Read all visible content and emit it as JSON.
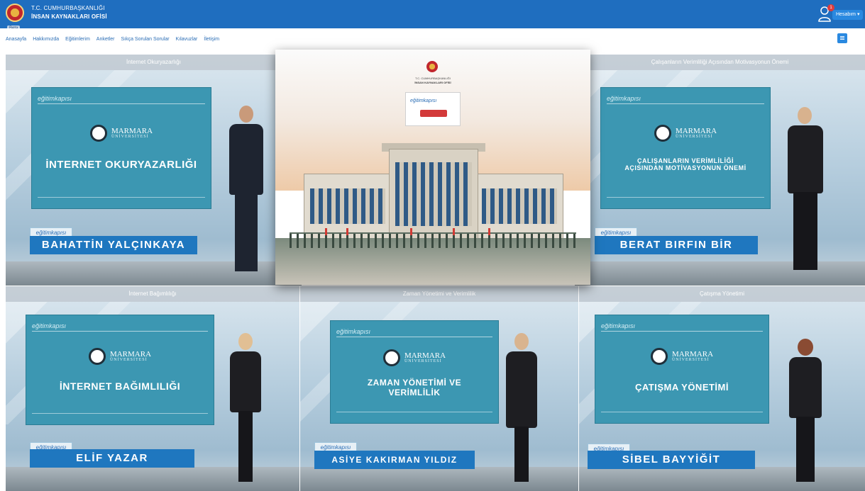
{
  "header": {
    "org_line1": "T.C. CUMHURBAŞKANLIĞI",
    "org_line2": "İNSAN KAYNAKLARI OFİSİ",
    "beta": "Beta",
    "notifications_count": "1",
    "account_label": "Hesabım ▾",
    "icons": {
      "user": "user-icon",
      "logo": "state-emblem-icon",
      "menu": "menu-icon"
    },
    "colors": {
      "header_bg": "#1f6ebf",
      "accent": "#2a89e0"
    }
  },
  "nav": {
    "items": [
      "Anasayfa",
      "Hakkımızda",
      "Eğitimlerim",
      "Anketler",
      "Sıkça Sorulan Sorular",
      "Kılavuzlar",
      "İletişim"
    ]
  },
  "tiles": [
    {
      "title": "İnternet Okuryazarlığı",
      "slide_title": "İNTERNET OKURYAZARLIĞI",
      "presenter": "BAHATTİN YALÇINKAYA"
    },
    {
      "title": "Çalışanların Verimliliği Açısından Motivasyonun Önemi",
      "slide_title": "ÇALIŞANLARIN VERİMLİLİĞİ AÇISINDAN MOTİVASYONUN ÖNEMİ",
      "presenter": "BERAT BIRFIN BİR"
    },
    {
      "title": "İnternet Bağımlılığı",
      "slide_title": "İNTERNET BAĞIMLILIĞI",
      "presenter": "ELİF YAZAR"
    },
    {
      "title": "Zaman Yönetimi ve Verimlilik",
      "slide_title": "ZAMAN YÖNETİMİ VE VERİMLİLİK",
      "presenter": "ASİYE KAKIRMAN YILDIZ"
    },
    {
      "title": "Çatışma Yönetimi",
      "slide_title": "ÇATIŞMA YÖNETİMİ",
      "presenter": "SİBEL BAYYİĞİT"
    }
  ],
  "slide_common": {
    "brand": "eğitimkapısı",
    "university": "MARMARA",
    "university_sub": "ÜNİVERSİTESİ",
    "slide_color": "#3c97b2",
    "plate_color": "#1f77bf"
  }
}
